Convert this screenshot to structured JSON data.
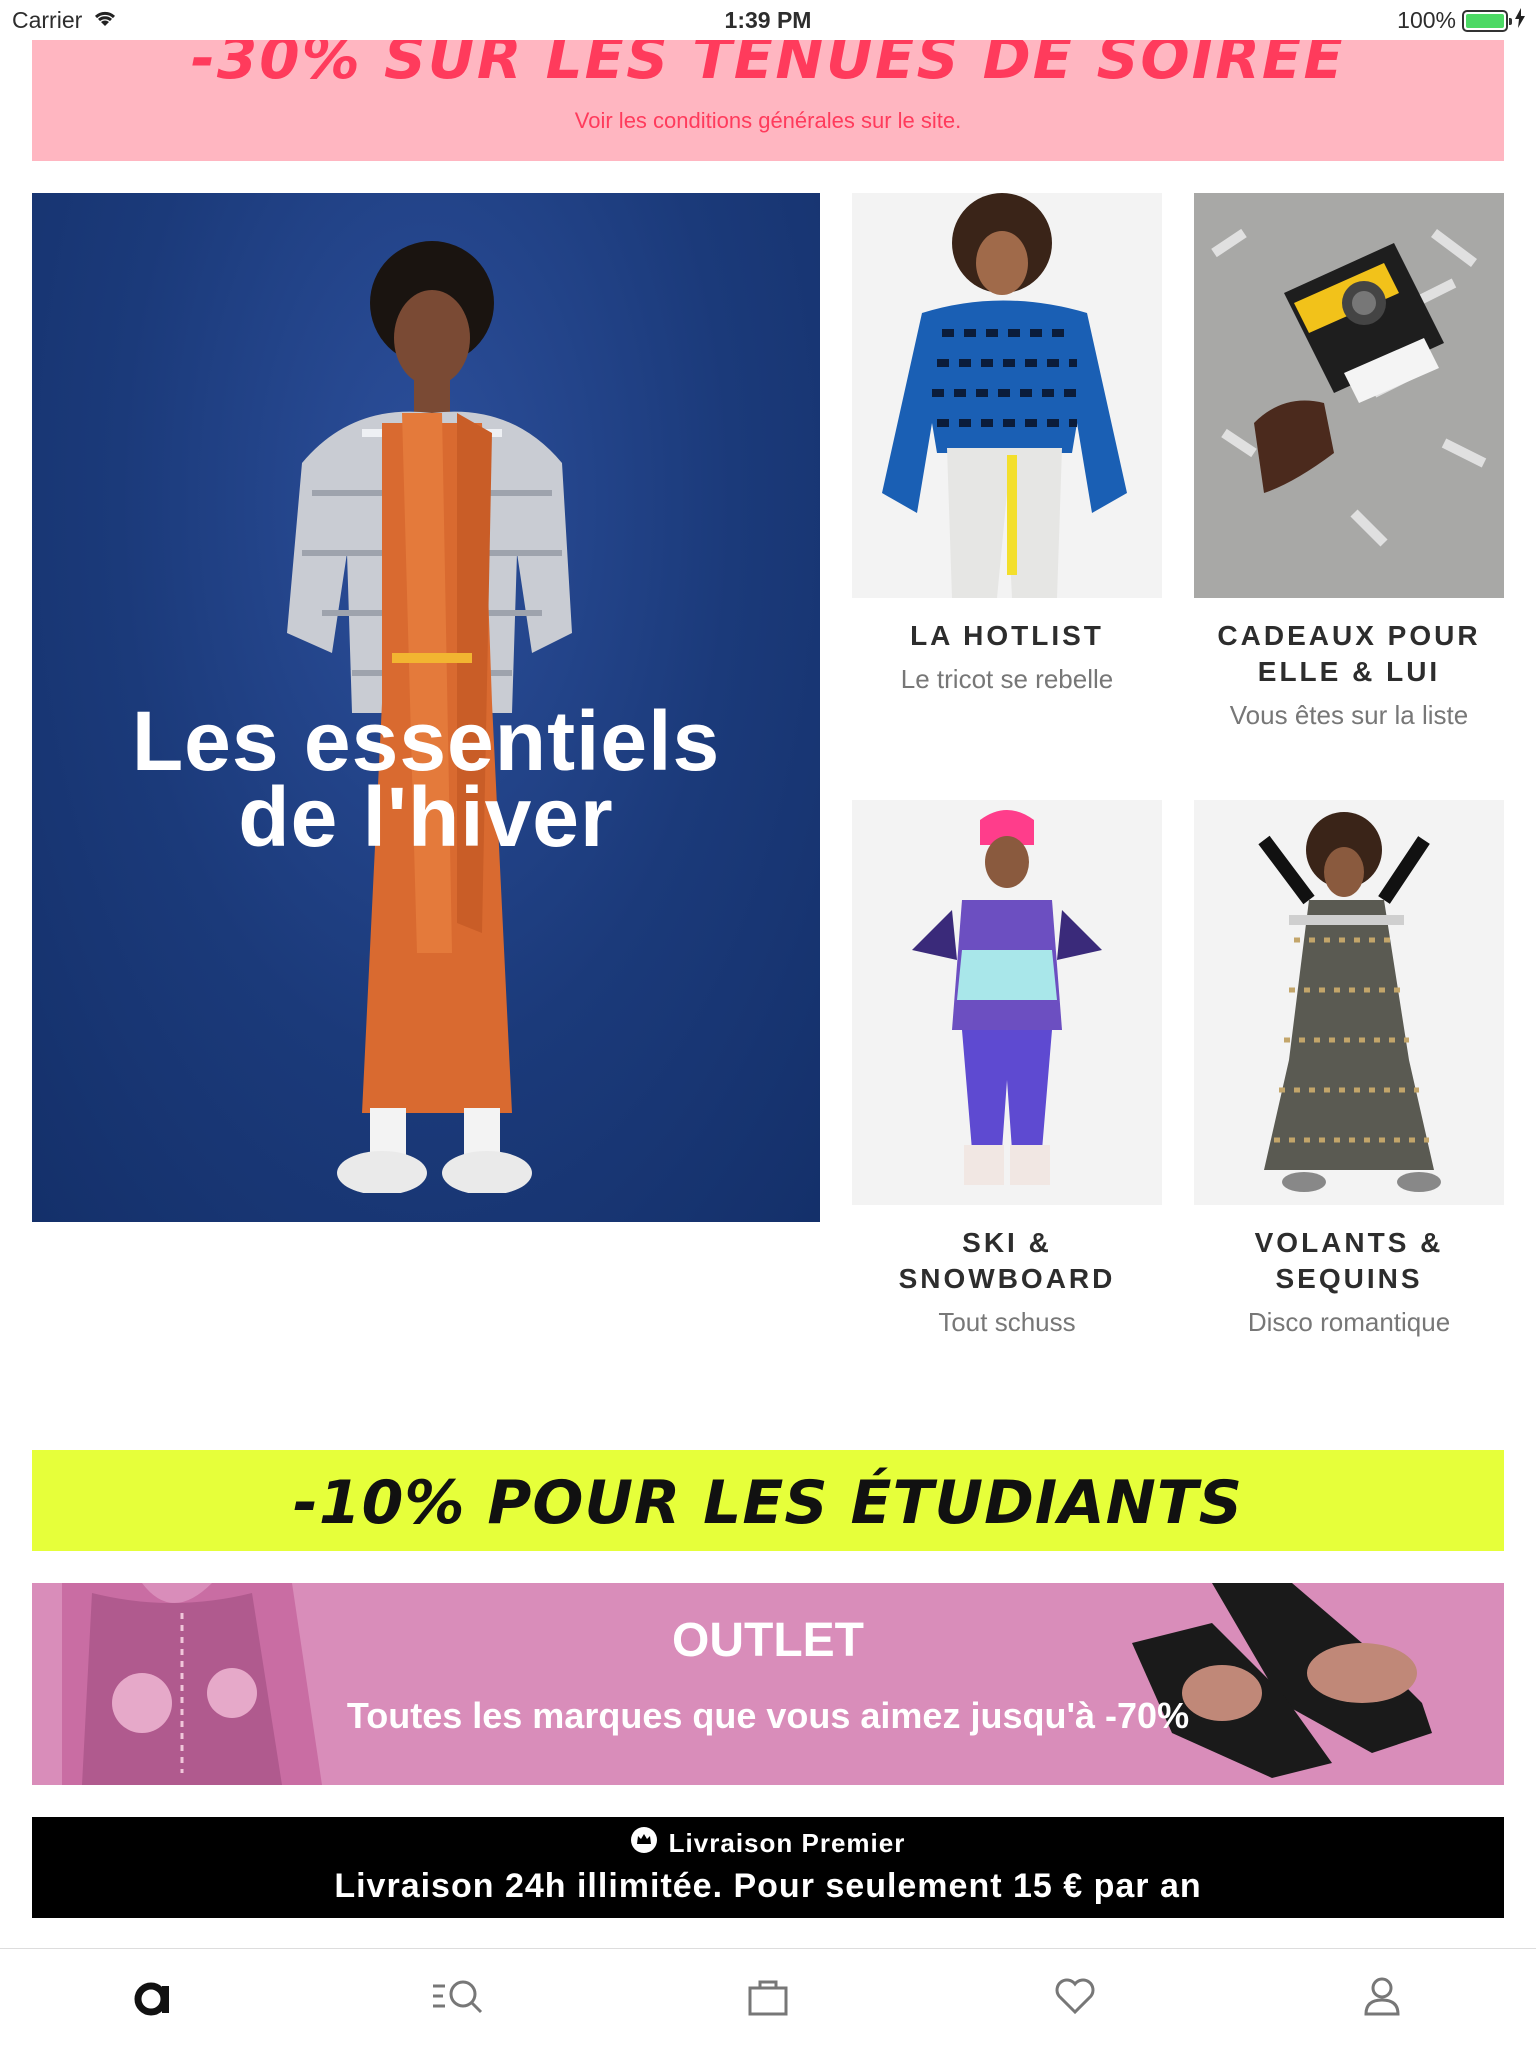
{
  "status_bar": {
    "carrier": "Carrier",
    "time": "1:39 PM",
    "battery": "100%"
  },
  "promo_soiree": {
    "headline": "-30% SUR LES TENUES DE SOIRÉE",
    "sub": "Voir les conditions générales sur le site."
  },
  "hero": {
    "title_line1": "Les essentiels",
    "title_line2": "de l'hiver"
  },
  "tiles": [
    {
      "title": "LA HOTLIST",
      "subtitle": "Le tricot se rebelle"
    },
    {
      "title": "CADEAUX POUR ELLE & LUI",
      "subtitle": "Vous êtes sur la liste"
    },
    {
      "title": "SKI & SNOWBOARD",
      "subtitle": "Tout schuss"
    },
    {
      "title": "VOLANTS & SEQUINS",
      "subtitle": "Disco romantique"
    }
  ],
  "student_banner": {
    "text": "-10% POUR LES ÉTUDIANTS"
  },
  "outlet": {
    "title": "OUTLET",
    "subtitle": "Toutes les marques que vous aimez jusqu'à -70%"
  },
  "premier": {
    "label": "Livraison Premier",
    "text": "Livraison 24h illimitée. Pour seulement 15 € par an"
  },
  "tab_bar": {
    "items": [
      {
        "icon": "home-logo-icon"
      },
      {
        "icon": "search-icon"
      },
      {
        "icon": "bag-icon"
      },
      {
        "icon": "heart-icon"
      },
      {
        "icon": "account-icon"
      }
    ]
  },
  "colors": {
    "promo_pink": "#ffb6c1",
    "promo_red": "#ff3b5c",
    "hero_blue": "#1b3a7a",
    "student_yellow": "#e6ff3a",
    "outlet_pink": "#d98dba"
  }
}
